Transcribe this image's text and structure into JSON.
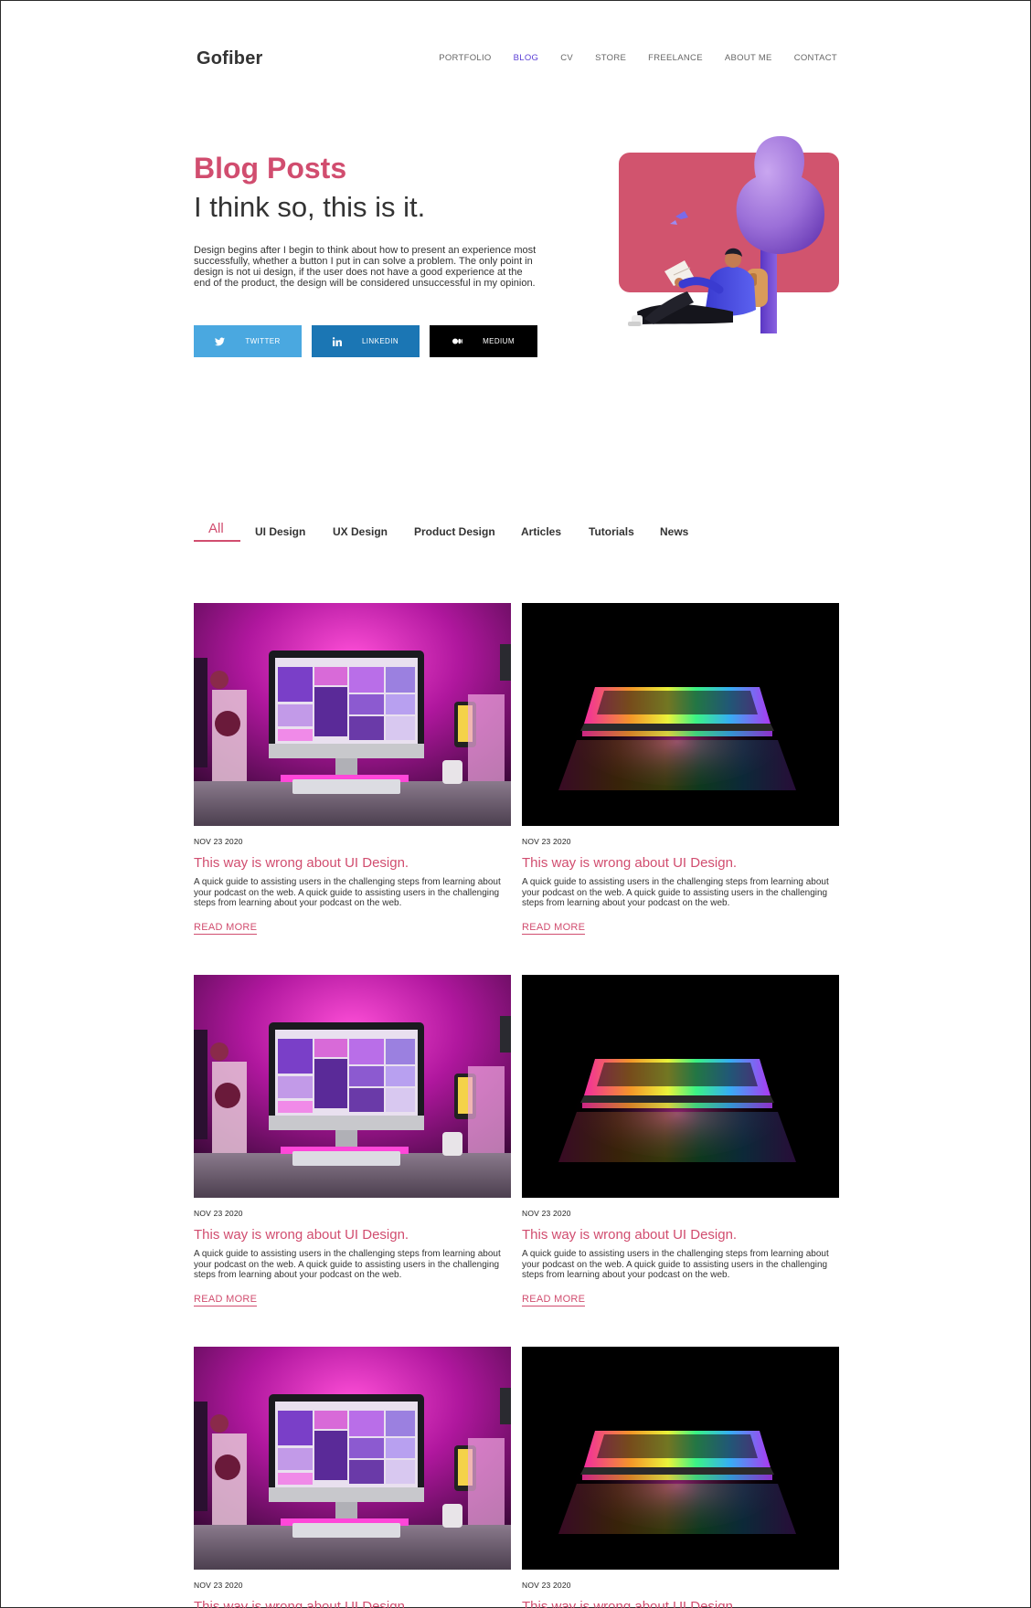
{
  "header": {
    "logo": "Gofiber",
    "nav": [
      {
        "label": "PORTFOLIO",
        "active": false
      },
      {
        "label": "BLOG",
        "active": true
      },
      {
        "label": "CV",
        "active": false
      },
      {
        "label": "STORE",
        "active": false
      },
      {
        "label": "FREELANCE",
        "active": false
      },
      {
        "label": "ABOUT ME",
        "active": false
      },
      {
        "label": "CONTACT",
        "active": false
      }
    ]
  },
  "hero": {
    "title": "Blog Posts",
    "subtitle": "I think so, this is it.",
    "description": "Design begins after I begin to think about how to present an experience most successfully, whether a button I put in can solve a problem. The only point in design is not ui design, if the user does not have a good experience at the end of the product, the design will be considered unsuccessful in my opinion.",
    "social": [
      {
        "label": "TWITTER",
        "icon": "twitter-icon",
        "color": "#4aa8e0"
      },
      {
        "label": "LINKEDIN",
        "icon": "linkedin-icon",
        "color": "#1b76b4"
      },
      {
        "label": "MEDIUM",
        "icon": "medium-icon",
        "color": "#000000"
      }
    ]
  },
  "filters": {
    "tabs": [
      "All",
      "UI Design",
      "UX Design",
      "Product Design",
      "Articles",
      "Tutorials",
      "News"
    ],
    "active": "All"
  },
  "posts": [
    {
      "image": "pink-desk-imac-photo",
      "date": "NOV 23 2020",
      "title": "This way is wrong about UI Design.",
      "excerpt": "A quick guide to assisting users in the challenging steps from learning about your podcast on the web.  A quick guide to assisting users in the challenging steps from learning about your podcast on the web.",
      "cta": "READ MORE"
    },
    {
      "image": "rgb-laptop-photo",
      "date": "NOV 23 2020",
      "title": "This way is wrong about UI Design.",
      "excerpt": "A quick guide to assisting users in the challenging steps from learning about your podcast on the web.  A quick guide to assisting users in the challenging steps from learning about your podcast on the web.",
      "cta": "READ MORE"
    },
    {
      "image": "pink-desk-imac-photo",
      "date": "NOV 23 2020",
      "title": "This way is wrong about UI Design.",
      "excerpt": "A quick guide to assisting users in the challenging steps from learning about your podcast on the web.  A quick guide to assisting users in the challenging steps from learning about your podcast on the web.",
      "cta": "READ MORE"
    },
    {
      "image": "rgb-laptop-photo",
      "date": "NOV 23 2020",
      "title": "This way is wrong about UI Design.",
      "excerpt": "A quick guide to assisting users in the challenging steps from learning about your podcast on the web.  A quick guide to assisting users in the challenging steps from learning about your podcast on the web.",
      "cta": "READ MORE"
    },
    {
      "image": "pink-desk-imac-photo",
      "date": "NOV 23 2020",
      "title": "This way is wrong about UI Design.",
      "excerpt": "",
      "cta": ""
    },
    {
      "image": "rgb-laptop-photo",
      "date": "NOV 23 2020",
      "title": "This way is wrong about UI Design.",
      "excerpt": "",
      "cta": ""
    }
  ],
  "colors": {
    "accent": "#d14d6f",
    "nav_active": "#5b3fd6",
    "text": "#333333"
  }
}
